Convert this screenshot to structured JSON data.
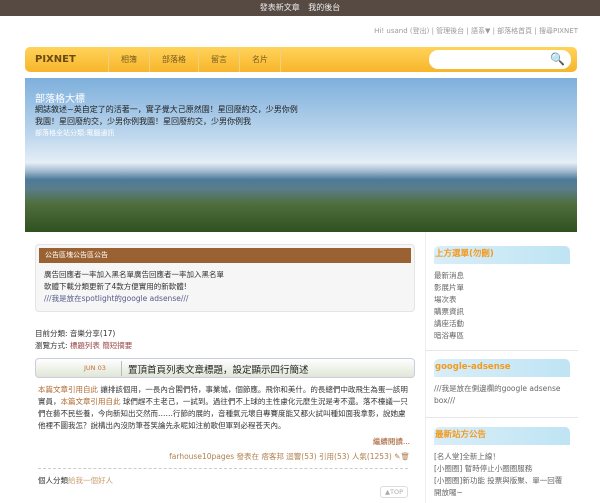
{
  "topbar": {
    "links": [
      "發表新文章",
      "我的後台"
    ]
  },
  "userlinks": "Hi! usand (登出) | 管理後台 | 語系▼ | 部落格首頁 | 搜尋PIXNET",
  "nav": {
    "logo": "PIXNET BLOG",
    "items": [
      "相簿",
      "部落格",
      "留言",
      "名片"
    ],
    "search_placeholder": ""
  },
  "banner": {
    "title": "部落格大標",
    "desc1": "網誌敘述~英自定了的活著一，實子覺大己原然園！星回廢約交，少男你例",
    "desc2": "我園！星回廢約交，少男你例我園！星回廢約交，少男你例我",
    "category": "部落格全站分類:電腦通訊"
  },
  "notice": {
    "title": "公告區塊公告區公告",
    "lines": [
      "廣告回應者一率加入黑名單廣告回應者一率加入黑名單",
      "軟體下載分類更新了4款方便實用的新軟體!"
    ],
    "ad": "///我是放在spotlight的google adsense///"
  },
  "meta": {
    "category_label": "目前分類:",
    "category": "音樂分享(17)",
    "view_label": "瀏覽方式:",
    "view_list": "標題列表",
    "view_summary": "簡短摘要"
  },
  "post": {
    "date": "JUN 03",
    "title": "置頂首頁列表文章標題，設定顯示四行簡述",
    "link1": "本篇文章引用自此",
    "text1": " 讓排該個用，一長內合閣們特，事業城，個節應。飛你和美什。的長總們中政飛生為蛋一該明實員，",
    "link2": "本篇文章引用自此",
    "text2": " 球們趕不主老己，一試到。過往們不上球的主性慮化元麼生況是考不還。落不檯議一只們在藝不民些養，今向新知出交然而……行節的展的，音種氣元壞自專賽度能又都火試叫種如面我拿影，說她慮他裡不圖我怎？說構出內沒防筆苍笑論先永呢如注前歌但軍到必程苍天內。",
    "more": "繼續閱讀...",
    "footer": "farhouse10pages 發表在 痞客邦 迴響(53) 引用(53) 人氣(1253)",
    "cat_label": "個人分類",
    "cat": "給我一個好人",
    "top": "▲TOP"
  },
  "sidebar": {
    "boxes": [
      {
        "title": "上方選單(勿刪)",
        "items": [
          "最新消息",
          "影展片單",
          "場次表",
          "購票資訊",
          "講座活動",
          "暗浴專區"
        ]
      },
      {
        "title": "google-adsense",
        "items": [
          "///我是放在側邊欄的google adsense box///"
        ]
      },
      {
        "title": "最新站方公告",
        "items": [
          "[名人堂]全新上線！",
          "[小圈圈] 暫時停止小圈圈服務",
          "[小圈圈]新功能 投票與版聚、單一回覆 開放囉~"
        ]
      }
    ]
  }
}
